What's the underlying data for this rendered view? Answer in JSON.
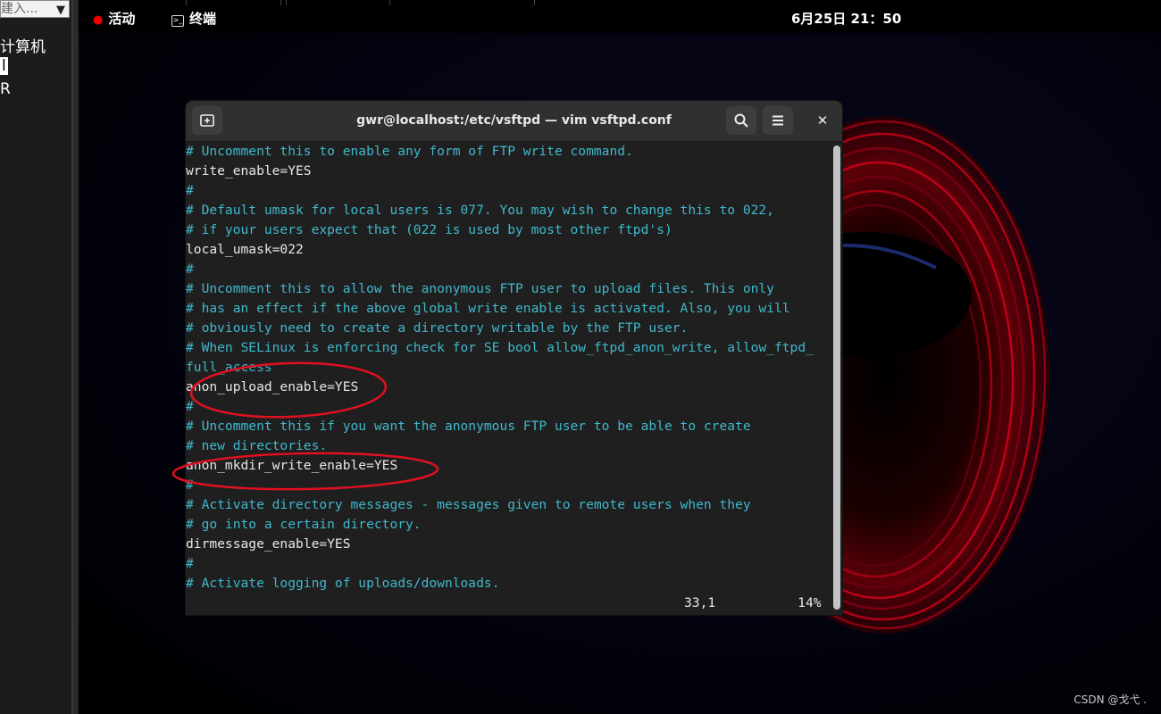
{
  "left_pane": {
    "input_text": "建入...",
    "items": [
      "计算机",
      "l",
      "R"
    ]
  },
  "topbar": {
    "activities": "活动",
    "app_name": "终端",
    "clock": "6月25日  21：50"
  },
  "terminal": {
    "title": "gwr@localhost:/etc/vsftpd — vim vsftpd.conf",
    "lines": [
      {
        "kind": "comment",
        "text": "# Uncomment this to enable any form of FTP write command."
      },
      {
        "kind": "value",
        "text": "write_enable=YES"
      },
      {
        "kind": "comment",
        "text": "#"
      },
      {
        "kind": "comment",
        "text": "# Default umask for local users is 077. You may wish to change this to 022,"
      },
      {
        "kind": "comment",
        "text": "# if your users expect that (022 is used by most other ftpd's)"
      },
      {
        "kind": "value",
        "text": "local_umask=022"
      },
      {
        "kind": "comment",
        "text": "#"
      },
      {
        "kind": "comment",
        "text": "# Uncomment this to allow the anonymous FTP user to upload files. This only"
      },
      {
        "kind": "comment",
        "text": "# has an effect if the above global write enable is activated. Also, you will"
      },
      {
        "kind": "comment",
        "text": "# obviously need to create a directory writable by the FTP user."
      },
      {
        "kind": "comment",
        "text": "# When SELinux is enforcing check for SE bool allow_ftpd_anon_write, allow_ftpd_"
      },
      {
        "kind": "comment",
        "text": "full_access"
      },
      {
        "kind": "value",
        "text": "anon_upload_enable=YES"
      },
      {
        "kind": "comment",
        "text": "#"
      },
      {
        "kind": "comment",
        "text": "# Uncomment this if you want the anonymous FTP user to be able to create"
      },
      {
        "kind": "comment",
        "text": "# new directories."
      },
      {
        "kind": "value",
        "text": "anon_mkdir_write_enable=YES"
      },
      {
        "kind": "comment",
        "text": "#"
      },
      {
        "kind": "comment",
        "text": "# Activate directory messages - messages given to remote users when they"
      },
      {
        "kind": "comment",
        "text": "# go into a certain directory."
      },
      {
        "kind": "value",
        "text": "dirmessage_enable=YES"
      },
      {
        "kind": "comment",
        "text": "#"
      },
      {
        "kind": "comment",
        "text": "# Activate logging of uploads/downloads."
      }
    ],
    "status_position": "33,1",
    "status_percent": "14%"
  },
  "watermark": "CSDN @戈弋 .",
  "colors": {
    "comment": "#3fb8cc",
    "value": "#e8e8e8",
    "annotation": "#e01020"
  }
}
